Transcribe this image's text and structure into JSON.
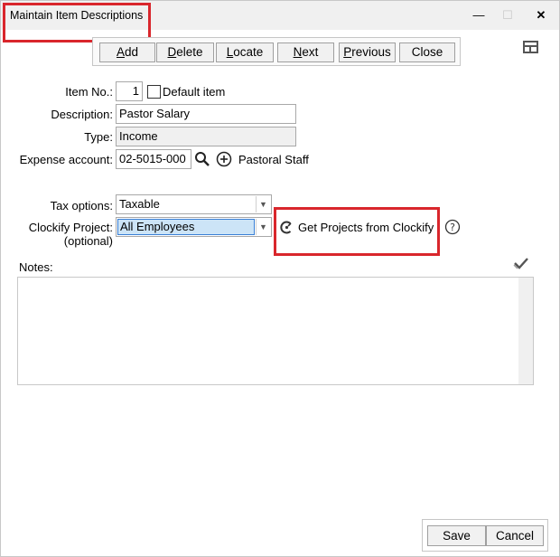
{
  "window": {
    "title": "Maintain Item Descriptions",
    "controls": {
      "minimize": "—",
      "maximize": "☐",
      "close": "✕"
    }
  },
  "toolbar": {
    "add": {
      "mnemonic": "A",
      "rest": "dd"
    },
    "delete": {
      "mnemonic": "D",
      "rest": "elete"
    },
    "locate": {
      "mnemonic": "L",
      "rest": "ocate"
    },
    "next": {
      "mnemonic": "N",
      "rest": "ext"
    },
    "previous": {
      "mnemonic": "P",
      "rest": "revious"
    },
    "close": "Close"
  },
  "form": {
    "item_no_label": "Item No.:",
    "item_no": "1",
    "default_item_label": "Default item",
    "description_label": "Description:",
    "description": "Pastor Salary",
    "type_label": "Type:",
    "type": "Income",
    "expense_account_label": "Expense account:",
    "expense_account": "02-5015-000",
    "expense_account_name": "Pastoral Staff",
    "tax_options_label": "Tax options:",
    "tax_options": "Taxable",
    "clockify_label": "Clockify Project:",
    "clockify_label_sub": "(optional)",
    "clockify_project": "All Employees",
    "get_projects": "Get Projects from Clockify",
    "notes_label": "Notes:"
  },
  "footer": {
    "save": "Save",
    "cancel": "Cancel"
  },
  "colors": {
    "highlight": "#d9262c",
    "selection": "#cce4f7"
  }
}
